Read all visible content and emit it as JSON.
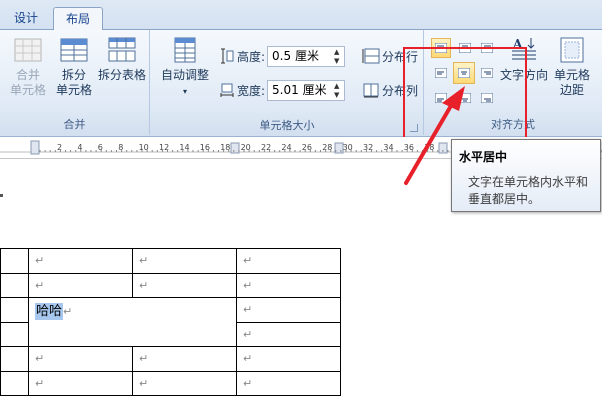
{
  "tabs": {
    "design": "设计",
    "layout": "布局"
  },
  "merge_group": {
    "label": "合并",
    "merge_cells_line1": "合并",
    "merge_cells_line2": "单元格",
    "split_cells_line1": "拆分",
    "split_cells_line2": "单元格",
    "split_table": "拆分表格"
  },
  "cell_size_group": {
    "label": "单元格大小",
    "auto_fit": "自动调整",
    "height_label": "高度:",
    "height_value": "0.5 厘米",
    "width_label": "宽度:",
    "width_value": "5.01 厘米",
    "distribute_rows": "分布行",
    "distribute_cols": "分布列"
  },
  "alignment_group": {
    "label": "对齐方式",
    "text_direction_line1": "文字方向",
    "cell_margins_line1": "单元格",
    "cell_margins_line2": "边距",
    "active_alignment": "middle-center"
  },
  "ruler": {
    "numbers": [
      "2",
      "4",
      "6",
      "8",
      "10",
      "12",
      "14",
      "16",
      "18",
      "20",
      "22",
      "24",
      "26",
      "28",
      "30",
      "32",
      "34",
      "36",
      "38"
    ]
  },
  "document": {
    "cell_mark": "↵",
    "selected_text": "哈哈"
  },
  "tooltip": {
    "title": "水平居中",
    "body": "文字在单元格内水平和垂直都居中。"
  },
  "colors": {
    "highlight_border": "#e8202a",
    "active_button": "#ffd974",
    "selection": "#a7c7ef"
  }
}
